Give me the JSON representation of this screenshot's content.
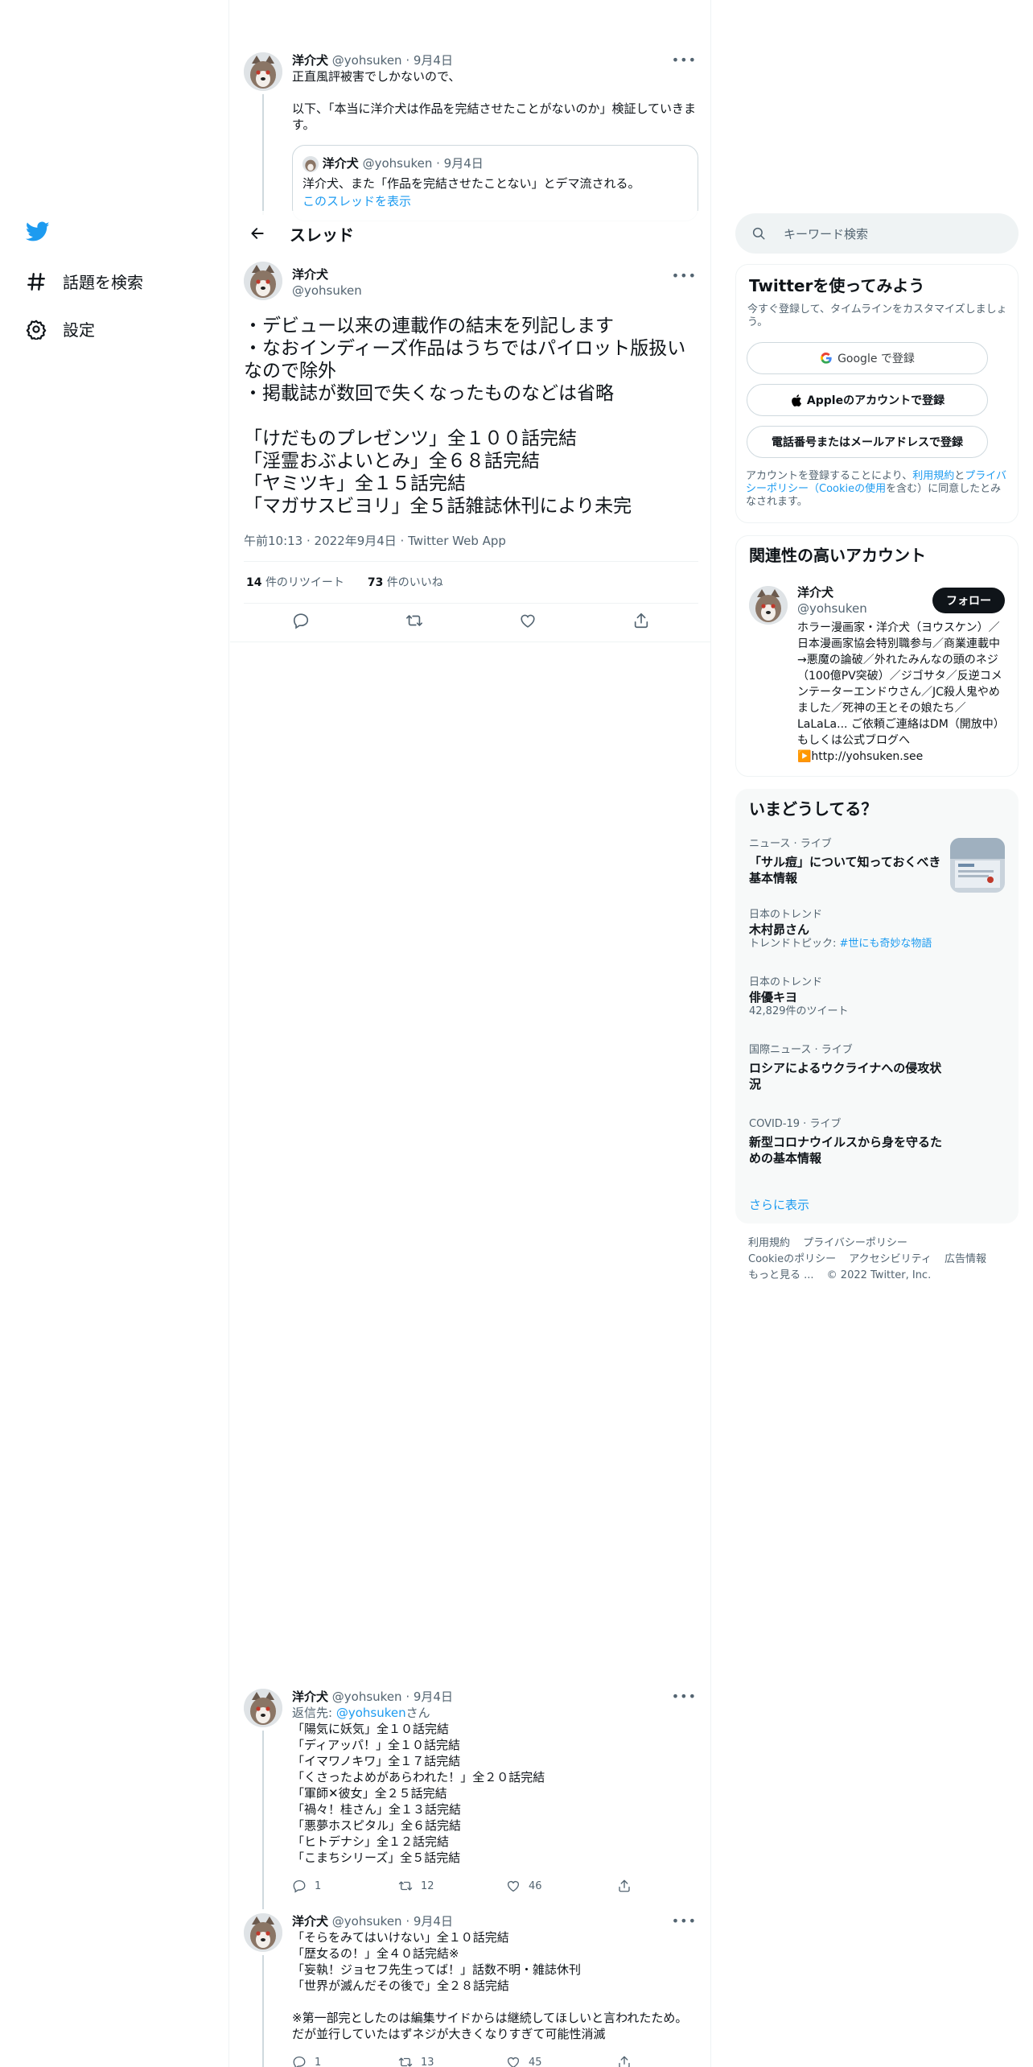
{
  "nav": {
    "explore_label": "話題を検索",
    "settings_label": "設定"
  },
  "header": {
    "title": "スレッド"
  },
  "prev_tweet": {
    "name": "洋介犬",
    "meta": "@yohsuken · 9月4日",
    "line1": "正直風評被害でしかないので、",
    "line2": "以下、「本当に洋介犬は作品を完結させたことがないのか」検証していきます。",
    "quote": {
      "name": "洋介犬",
      "meta": "@yohsuken · 9月4日",
      "text": "洋介犬、また「作品を完結させたことない」とデマ流される。",
      "link": "このスレッドを表示"
    }
  },
  "focus_tweet": {
    "name": "洋介犬",
    "handle": "@yohsuken",
    "text": "・デビュー以来の連載作の結末を列記します\n・なおインディーズ作品はうちではパイロット版扱いなので除外\n・掲載誌が数回で失くなったものなどは省略\n\n「けだものプレゼンツ」全１００話完結\n「淫霊おぶよいとみ」全６８話完結\n「ヤミツキ」全１５話完結\n「マガサスビヨリ」全５話雑誌休刊により未完",
    "timestamp": "午前10:13 · 2022年9月4日 · Twitter Web App",
    "retweets_count": "14",
    "retweets_label": "件のリツイート",
    "likes_count": "73",
    "likes_label": "件のいいね"
  },
  "reply1": {
    "name": "洋介犬",
    "meta": "@yohsuken · 9月4日",
    "reply_to_prefix": "返信先: ",
    "reply_to_handle": "@yohsuken",
    "reply_to_suffix": "さん",
    "text": "「陽気に妖気」全１０話完結\n「ディアッパ！」全１０話完結\n「イマワノキワ」全１７話完結\n「くさったよめがあらわれた！」全２０話完結\n「軍師✕彼女」全２５話完結\n「禍々！桂さん」全１３話完結\n「悪夢ホスピタル」全６話完結\n「ヒトデナシ」全１２話完結\n「こまちシリーズ」全５話完結",
    "replies": "1",
    "retweets": "12",
    "likes": "46"
  },
  "reply2": {
    "name": "洋介犬",
    "meta": "@yohsuken · 9月4日",
    "text": "「そらをみてはいけない」全１０話完結\n「歴女るの！」全４０話完結※\n「妄執！ジョセフ先生ってば！」話数不明・雑誌休刊\n「世界が滅んだその後で」全２８話完結\n\n※第一部完としたのは編集サイドからは継続してほしいと言われたため。\nだが並行していたはずネジが大きくなりすぎて可能性消滅",
    "replies": "1",
    "retweets": "13",
    "likes": "45"
  },
  "search": {
    "placeholder": "キーワード検索"
  },
  "signup": {
    "title": "Twitterを使ってみよう",
    "subtitle": "今すぐ登録して、タイムラインをカスタマイズしましょう。",
    "google": "Google で登録",
    "apple": "Appleのアカウントで登録",
    "phone": "電話番号またはメールアドレスで登録",
    "legal_prefix": "アカウントを登録することにより、",
    "legal_link1": "利用規約",
    "legal_and": "と",
    "legal_link2": "プライバシーポリシー（Cookieの使用",
    "legal_suffix": "を含む）に同意したとみなされます。"
  },
  "related": {
    "title": "関連性の高いアカウント",
    "name": "洋介犬",
    "handle": "@yohsuken",
    "follow": "フォロー",
    "bio": "ホラー漫画家・洋介犬（ヨウスケン）／日本漫画家協会特別職参与／商業連載中→悪魔の論破／外れたみんなの頭のネジ（100億PV突破）／ジゴサタ／反逆コメンテーターエンドウさん／JC殺人鬼やめました／死神の王とその娘たち／LaLaLa... ご依頼ご連絡はDM（開放中）もしくは公式ブログへ",
    "bio_link": "▶️http://yohsuken.see"
  },
  "trends": {
    "title": "いまどうしてる？",
    "items": [
      {
        "category": "ニュース · ライブ",
        "title": "「サル痘」について知っておくべき基本情報",
        "extra": ""
      },
      {
        "category": "日本のトレンド",
        "title": "木村昴さん",
        "extra_prefix": "トレンドトピック: ",
        "extra_link": "#世にも奇妙な物語"
      },
      {
        "category": "日本のトレンド",
        "title": "俳優キヨ",
        "extra": "42,829件のツイート"
      },
      {
        "category": "国際ニュース · ライブ",
        "title": "ロシアによるウクライナへの侵攻状況",
        "extra": ""
      },
      {
        "category": "COVID-19 · ライブ",
        "title": "新型コロナウイルスから身を守るための基本情報",
        "extra": ""
      }
    ],
    "show_more": "さらに表示"
  },
  "footer": {
    "terms": "利用規約",
    "privacy": "プライバシーポリシー",
    "cookie": "Cookieのポリシー",
    "access": "アクセシビリティ",
    "ads": "広告情報",
    "more": "もっと見る ...",
    "copyright": "© 2022 Twitter, Inc."
  },
  "colors": {
    "accent": "#1d9bf0",
    "text": "#0f1419",
    "muted": "#536471",
    "border": "#eff3f4"
  },
  "icons": [
    "twitter-logo-icon",
    "hashtag-icon",
    "gear-icon",
    "back-arrow-icon",
    "search-icon",
    "more-icon",
    "reply-icon",
    "retweet-icon",
    "like-icon",
    "share-icon",
    "google-icon",
    "apple-icon"
  ]
}
